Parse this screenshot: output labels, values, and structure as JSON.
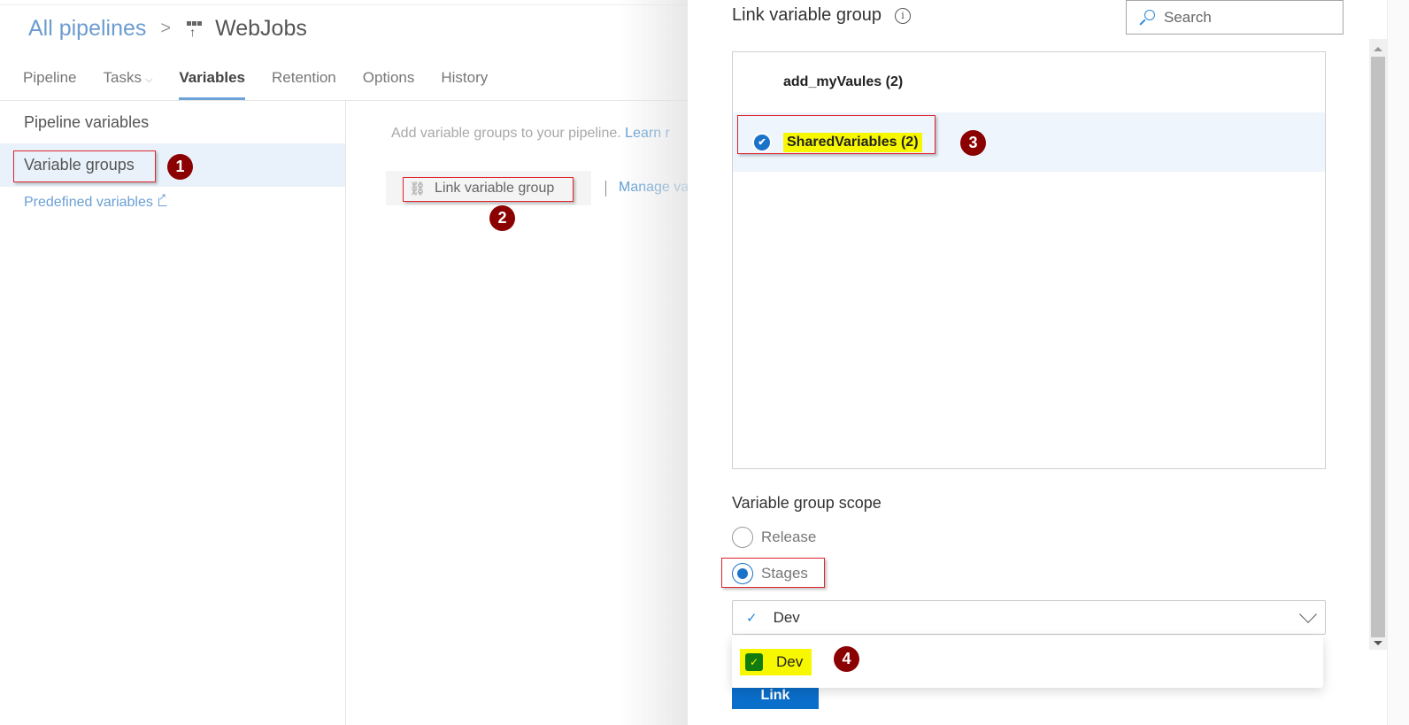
{
  "breadcrumb": {
    "parent": "All pipelines",
    "separator": ">",
    "current": "WebJobs",
    "current_icon": "pipeline-icon"
  },
  "tabs": [
    {
      "label": "Pipeline",
      "active": false
    },
    {
      "label": "Tasks",
      "active": false,
      "has_dropdown": true
    },
    {
      "label": "Variables",
      "active": true
    },
    {
      "label": "Retention",
      "active": false
    },
    {
      "label": "Options",
      "active": false
    },
    {
      "label": "History",
      "active": false
    }
  ],
  "sidebar": {
    "items": [
      {
        "label": "Pipeline variables",
        "selected": false
      },
      {
        "label": "Variable groups",
        "selected": true
      },
      {
        "label": "Predefined variables",
        "external": true
      }
    ]
  },
  "content": {
    "hint": "Add variable groups to your pipeline.",
    "learn_more": "Learn r",
    "link_button": "Link variable group",
    "manage_link": "Manage va"
  },
  "panel": {
    "title": "Link variable group",
    "info_icon": "info-icon",
    "search_placeholder": "Search",
    "groups": [
      {
        "name": "add_myVaules (2)",
        "selected": false
      },
      {
        "name": "SharedVariables (2)",
        "selected": true
      }
    ],
    "scope_label": "Variable group scope",
    "scope_options": [
      {
        "label": "Release",
        "selected": false
      },
      {
        "label": "Stages",
        "selected": true
      }
    ],
    "stage_select_value": "Dev",
    "stage_options": [
      {
        "label": "Dev",
        "checked": true
      }
    ],
    "link_button": "Link"
  },
  "annotations": [
    "1",
    "2",
    "3",
    "4"
  ],
  "colors": {
    "accent": "#1a73c9",
    "link": "#5b9bd5",
    "highlight": "#f7f700",
    "annotation_box": "#e0242d",
    "annotation_badge": "#8b0000",
    "primary_button": "#0a6ecb",
    "selected_row": "#eef5fd"
  }
}
